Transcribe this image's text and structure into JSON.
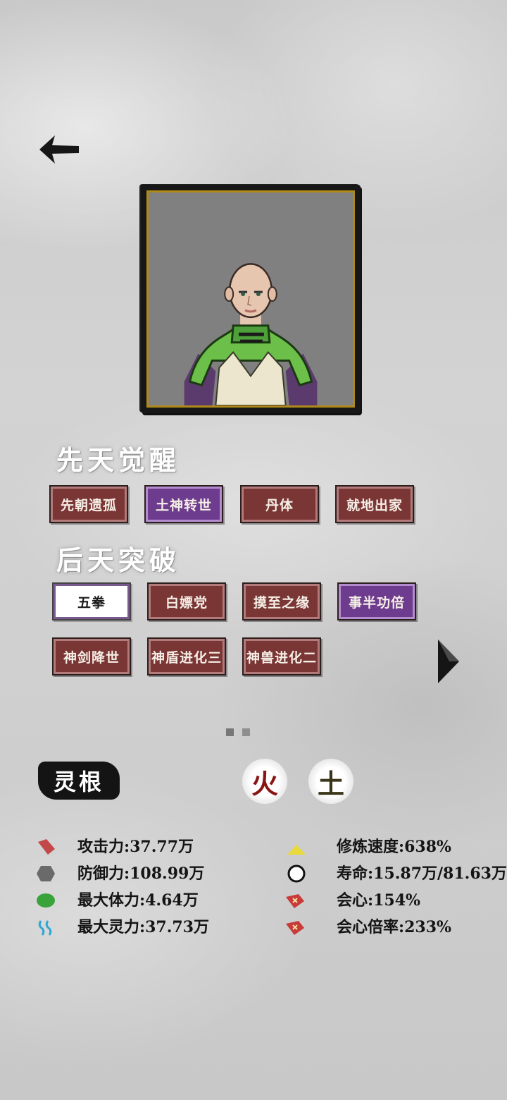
{
  "innate_title": "先天觉醒",
  "innate_traits": [
    {
      "label": "先朝遗孤",
      "style": "red"
    },
    {
      "label": "土神转世",
      "style": "purple"
    },
    {
      "label": "丹体",
      "style": "red"
    },
    {
      "label": "就地出家",
      "style": "red"
    }
  ],
  "acquired_title": "后天突破",
  "acquired_traits": [
    {
      "label": "五拳",
      "style": "white"
    },
    {
      "label": "白嫖党",
      "style": "red"
    },
    {
      "label": "摸至之缘",
      "style": "red"
    },
    {
      "label": "事半功倍",
      "style": "purple"
    },
    {
      "label": "神剑降世",
      "style": "red"
    },
    {
      "label": "神盾进化三",
      "style": "red"
    },
    {
      "label": "神兽进化二",
      "style": "red"
    }
  ],
  "pager": {
    "total": 2,
    "current": 1
  },
  "spirit_root": {
    "label": "灵根",
    "elements": [
      {
        "char": "火",
        "color": "#8a1414"
      },
      {
        "char": "土",
        "color": "#3a3418"
      }
    ]
  },
  "stats_left": [
    {
      "icon": "attack-icon",
      "text": "攻击力:37.77万"
    },
    {
      "icon": "defense-icon",
      "text": "防御力:108.99万"
    },
    {
      "icon": "stamina-icon",
      "text": "最大体力:4.64万"
    },
    {
      "icon": "spirit-icon",
      "text": "最大灵力:37.73万"
    }
  ],
  "stats_right": [
    {
      "icon": "cultivation-speed-icon",
      "text": "修炼速度:638%"
    },
    {
      "icon": "lifespan-icon",
      "text": "寿命:15.87万/81.63万"
    },
    {
      "icon": "crit-icon",
      "text": "会心:154%"
    },
    {
      "icon": "crit-multiplier-icon",
      "text": "会心倍率:233%"
    }
  ],
  "colors": {
    "tag_red": "#7a3535",
    "tag_purple": "#6e3c8e",
    "frame_gold": "#b08a18"
  }
}
